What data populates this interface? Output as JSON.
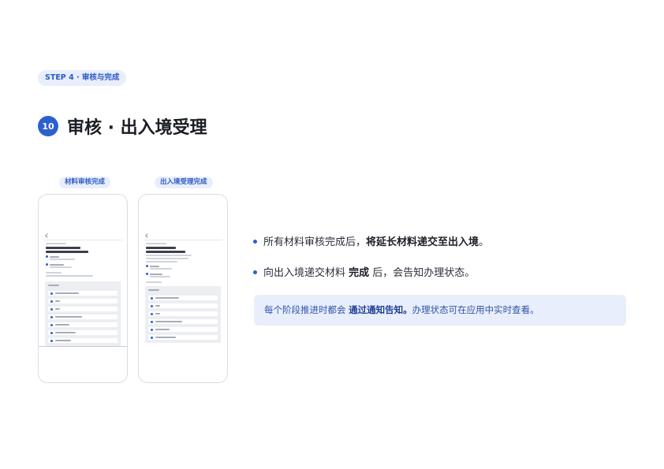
{
  "step_badge": "STEP 4 · 审核与完成",
  "section": {
    "number": "10",
    "title": "审核 · 出入境受理"
  },
  "phones": [
    {
      "label": "材料审核完成"
    },
    {
      "label": "出入境受理完成"
    }
  ],
  "bullets": [
    {
      "pre": "所有材料审核完成后，",
      "bold": "将延长材料递交至出入境",
      "post": "。"
    },
    {
      "pre": "向出入境递交材料 ",
      "bold": "完成",
      "post": " 后，会告知办理状态。"
    }
  ],
  "note": {
    "pre": "每个阶段推进时都会 ",
    "bold": "通过通知告知。",
    "post": "办理状态可在应用中实时查看。"
  },
  "colors": {
    "accent": "#2b5fd0",
    "badge_bg": "#e8eefb",
    "badge_text": "#2c5bc4"
  }
}
